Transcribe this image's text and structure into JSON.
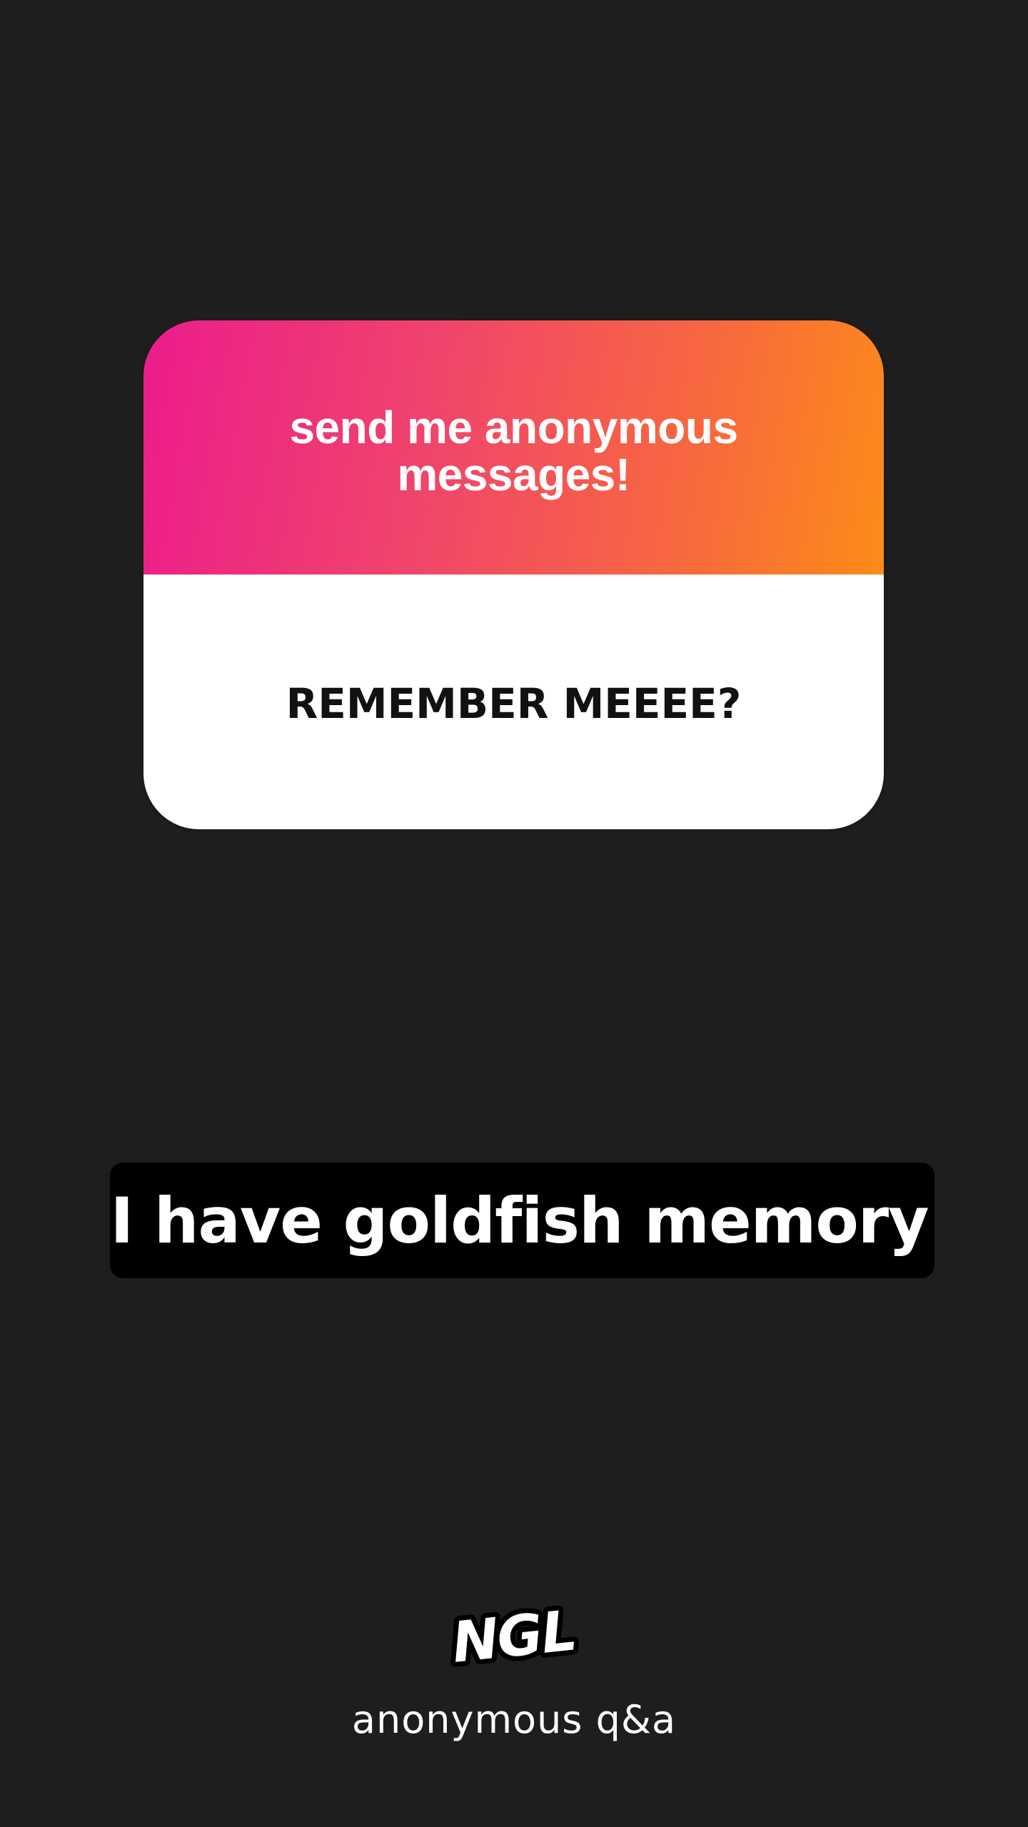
{
  "card": {
    "prompt": "send me anonymous messages!",
    "message": "REMEMBER MEEEE?",
    "gradient_colors": [
      "#ec1c8c",
      "#f0466a",
      "#f86a3c",
      "#fd8c18"
    ]
  },
  "reply": {
    "text": "I have goldfish memory"
  },
  "footer": {
    "logo_text": "NGL",
    "caption": "anonymous q&a"
  },
  "colors": {
    "background": "#1e1e1e",
    "reply_box": "#000000",
    "card_body": "#ffffff"
  }
}
